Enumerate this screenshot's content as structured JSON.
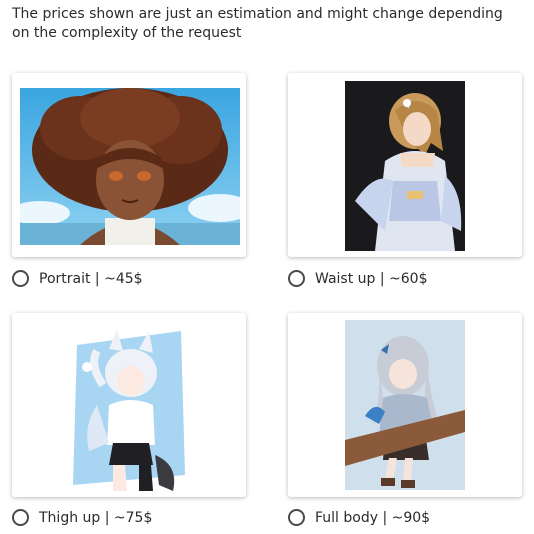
{
  "notice": "The prices shown are just an estimation and might change depending on the complexity of the request",
  "options": [
    {
      "label": "Portrait | ~45$",
      "image": "portrait-illustration",
      "selected": false
    },
    {
      "label": "Waist up | ~60$",
      "image": "waist-up-illustration",
      "selected": false
    },
    {
      "label": "Thigh up | ~75$",
      "image": "thigh-up-illustration",
      "selected": false
    },
    {
      "label": "Full body | ~90$",
      "image": "full-body-illustration",
      "selected": false
    }
  ],
  "colors": {
    "text": "#2b2b2b",
    "radio_border": "#4a4a4a",
    "card_bg": "#ffffff"
  }
}
